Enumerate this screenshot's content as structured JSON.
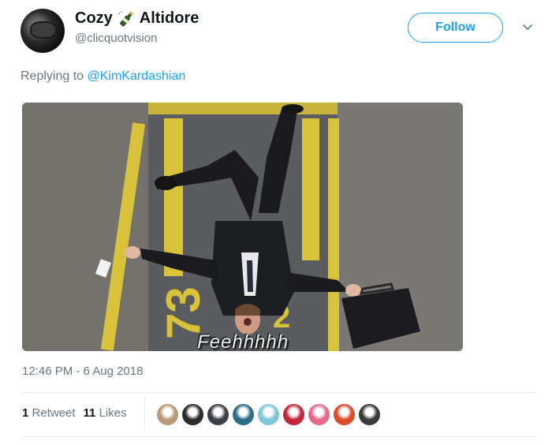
{
  "author": {
    "display_name_part1": "Cozy",
    "display_name_part2": "Altidore",
    "handle": "@clicquotvision",
    "avatar_icon": "dark-helmet-avatar"
  },
  "follow_label": "Follow",
  "reply": {
    "prefix": "Replying to",
    "mention": "@KimKardashian"
  },
  "media": {
    "caption": "Feehhhhh"
  },
  "timestamp": "12:46 PM - 6 Aug 2018",
  "stats": {
    "retweets_count": "1",
    "retweets_label": "Retweet",
    "likes_count": "11",
    "likes_label": "Likes"
  },
  "likers": [
    {
      "color": "#b89a78"
    },
    {
      "color": "#2b2b2b"
    },
    {
      "color": "#3b3f46"
    },
    {
      "color": "#2f6e8a"
    },
    {
      "color": "#7ec6d8"
    },
    {
      "color": "#c0283a"
    },
    {
      "color": "#e46a8a"
    },
    {
      "color": "#d94b2b"
    },
    {
      "color": "#3a3a3a"
    }
  ],
  "colors": {
    "accent": "#1da1f2",
    "muted": "#657786"
  }
}
